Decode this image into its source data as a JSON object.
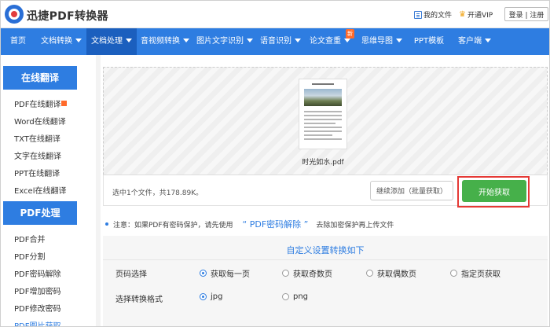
{
  "header": {
    "app_title": "迅捷PDF转换器",
    "my_files": "我的文件",
    "vip": "开通VIP",
    "auth": "登录 | 注册",
    "icons": [
      "app-logo-icon",
      "file-list-icon",
      "crown-icon"
    ]
  },
  "nav": {
    "items": [
      {
        "label": "首页"
      },
      {
        "label": "文档转换"
      },
      {
        "label": "文档处理"
      },
      {
        "label": "音视频转换"
      },
      {
        "label": "图片文字识别"
      },
      {
        "label": "语音识别"
      },
      {
        "label": "论文查重"
      },
      {
        "label": "思维导图"
      },
      {
        "label": "PPT模板"
      },
      {
        "label": "客户端"
      }
    ],
    "active": "文档处理",
    "new_badge": "新"
  },
  "sidebar": {
    "sections": [
      {
        "title": "在线翻译",
        "items": [
          {
            "label": "PDF在线翻译"
          },
          {
            "label": "Word在线翻译"
          },
          {
            "label": "TXT在线翻译"
          },
          {
            "label": "文字在线翻译"
          },
          {
            "label": "PPT在线翻译"
          },
          {
            "label": "Excel在线翻译"
          }
        ]
      },
      {
        "title": "PDF处理",
        "items": [
          {
            "label": "PDF合并"
          },
          {
            "label": "PDF分割"
          },
          {
            "label": "PDF密码解除"
          },
          {
            "label": "PDF增加密码"
          },
          {
            "label": "PDF修改密码"
          },
          {
            "label": "PDF图片获取"
          }
        ]
      }
    ]
  },
  "upload": {
    "file_name": "时光如水.pdf",
    "summary": "选中1个文件，共178.89K。",
    "continue_button": "继续添加（批量获取）",
    "start_button": "开始获取"
  },
  "notice": {
    "prefix": "注意：如果PDF有密码保护，请先使用",
    "link": "“ PDF密码解除 ”",
    "suffix": "去除加密保护再上传文件"
  },
  "settings": {
    "title": "自定义设置转换如下",
    "page_select": {
      "label": "页码选择",
      "options": [
        "获取每一页",
        "获取奇数页",
        "获取偶数页",
        "指定页获取"
      ],
      "selected": "获取每一页"
    },
    "format": {
      "label": "选择转换格式",
      "options": [
        "jpg",
        "png"
      ],
      "selected": "jpg"
    }
  },
  "colors": {
    "primary": "#2e7de1",
    "nav_active": "#1b5fbe",
    "start_button": "#46b04a",
    "highlight_frame": "#e53935",
    "new_badge": "#ff6a2a"
  }
}
